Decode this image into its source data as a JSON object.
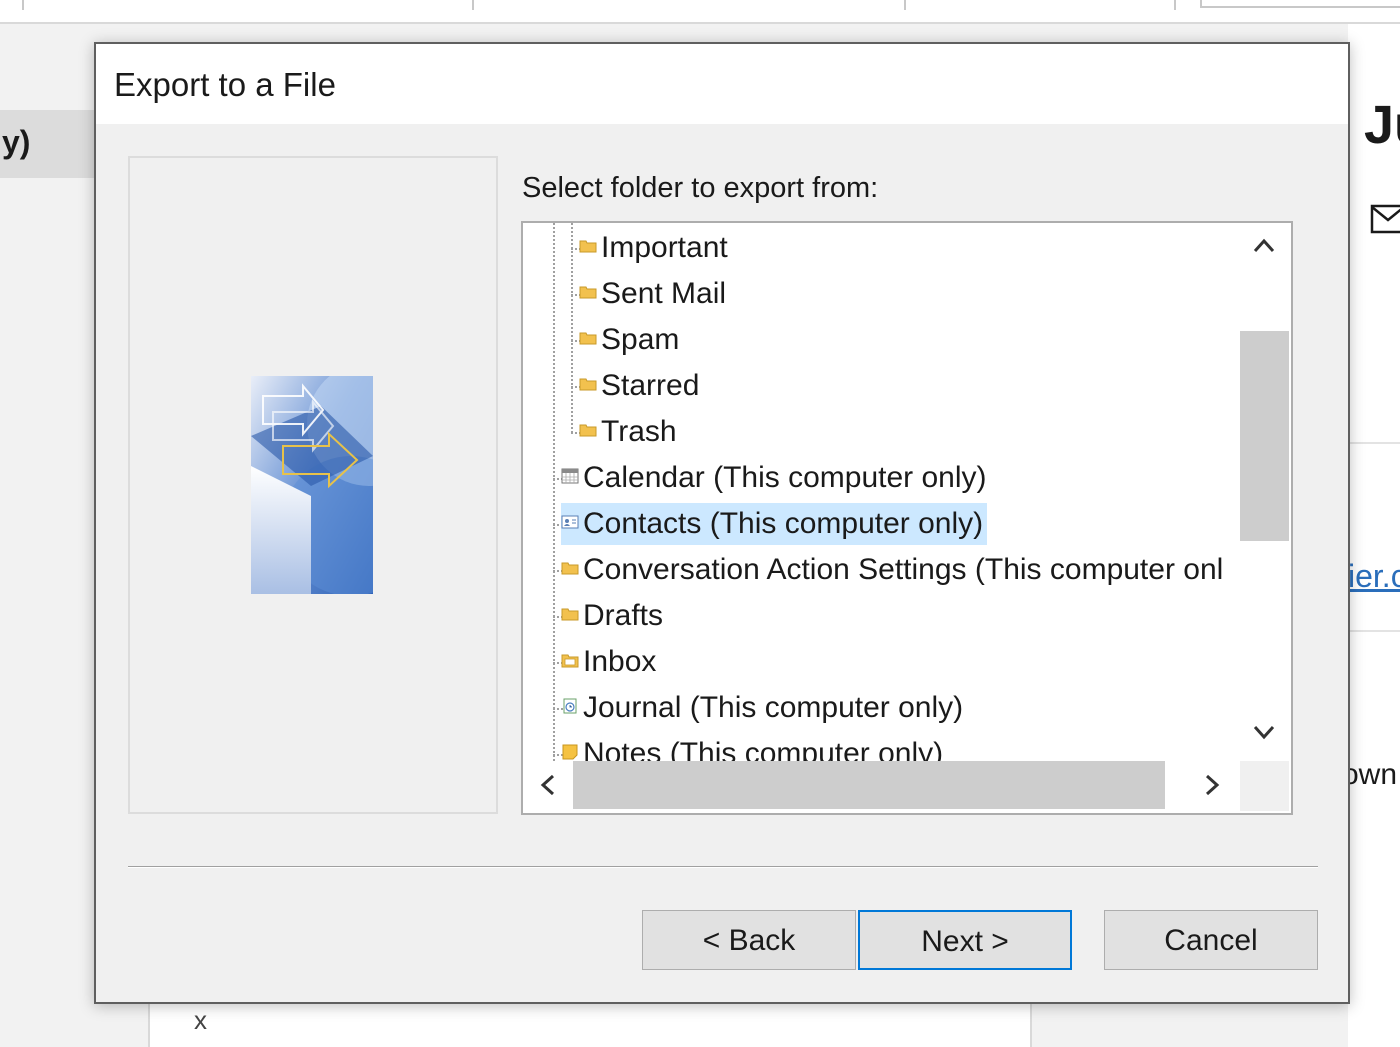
{
  "dialog": {
    "title": "Export to a File",
    "prompt": "Select folder to export from:",
    "tree_items": [
      {
        "label": "Important",
        "icon": "folder-icon"
      },
      {
        "label": "Sent Mail",
        "icon": "folder-icon"
      },
      {
        "label": "Spam",
        "icon": "folder-icon"
      },
      {
        "label": "Starred",
        "icon": "folder-icon"
      },
      {
        "label": "Trash",
        "icon": "folder-icon"
      },
      {
        "label": "Calendar (This computer only)",
        "icon": "calendar-icon"
      },
      {
        "label": "Contacts (This computer only)",
        "icon": "contacts-icon",
        "selected": true
      },
      {
        "label": "Conversation Action Settings (This computer onl",
        "icon": "folder-icon"
      },
      {
        "label": "Drafts",
        "icon": "folder-icon"
      },
      {
        "label": "Inbox",
        "icon": "inbox-icon"
      },
      {
        "label": "Journal (This computer only)",
        "icon": "journal-icon"
      },
      {
        "label": "Notes (This computer only)",
        "icon": "notes-icon"
      }
    ],
    "buttons": {
      "back": "< Back",
      "next": "Next >",
      "cancel": "Cancel"
    }
  },
  "background": {
    "left_selected_fragment": "y)",
    "right_heading_fragment": "Ju",
    "right_link_fragment": "ier.c",
    "right_text_fragment": "own",
    "bottom_text_fragment": "x"
  },
  "colors": {
    "selection": "#cce8ff",
    "default_button_border": "#0078d7",
    "folder": "#f2c14e"
  }
}
